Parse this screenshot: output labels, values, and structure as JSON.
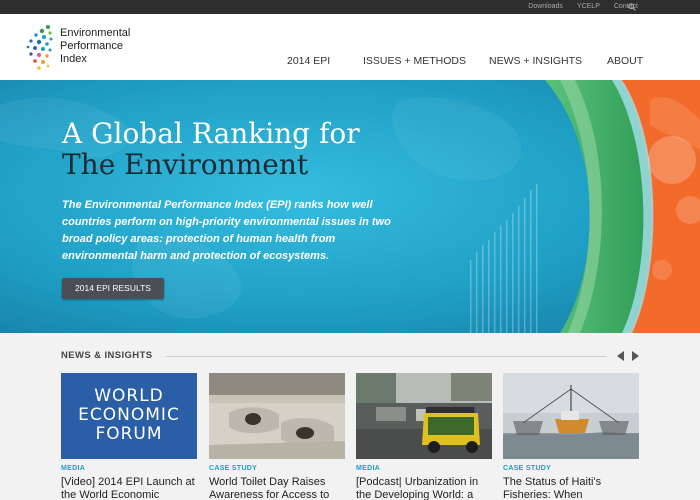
{
  "utility": {
    "links": [
      "Downloads",
      "YCELP",
      "Contact"
    ],
    "search_icon": "search-icon"
  },
  "logo": {
    "line1": "Environmental",
    "line2": "Performance",
    "line3": "Index"
  },
  "nav": {
    "items": [
      "2014 EPI",
      "ISSUES + METHODS",
      "NEWS + INSIGHTS",
      "ABOUT"
    ]
  },
  "hero": {
    "title_line1": "A Global Ranking for",
    "title_line2": "The Environment",
    "description": "The Environmental Performance Index (EPI) ranks how well countries perform on high-priority environmental issues in two broad policy areas: protection of human health from environmental harm and protection of ecosystems.",
    "cta_label": "2014 EPI RESULTS"
  },
  "news": {
    "heading": "NEWS & INSIGHTS",
    "cards": [
      {
        "kicker": "MEDIA",
        "title": "[Video] 2014 EPI Launch at the World Economic",
        "thumb_text": [
          "WORLD",
          "ECONOMIC",
          "FORUM"
        ]
      },
      {
        "kicker": "CASE STUDY",
        "title": "World Toilet Day Raises Awareness for Access to"
      },
      {
        "kicker": "MEDIA",
        "title": "[Podcast| Urbanization in the Developing World: a"
      },
      {
        "kicker": "CASE STUDY",
        "title": "The Status of Haiti's Fisheries: When"
      }
    ]
  },
  "colors": {
    "hero_blue": "#1f9fc5",
    "hero_green": "#3fb36b",
    "hero_orange": "#f26b2a",
    "accent_teal": "#1a9fc4",
    "wef_blue": "#2a5fa8"
  }
}
